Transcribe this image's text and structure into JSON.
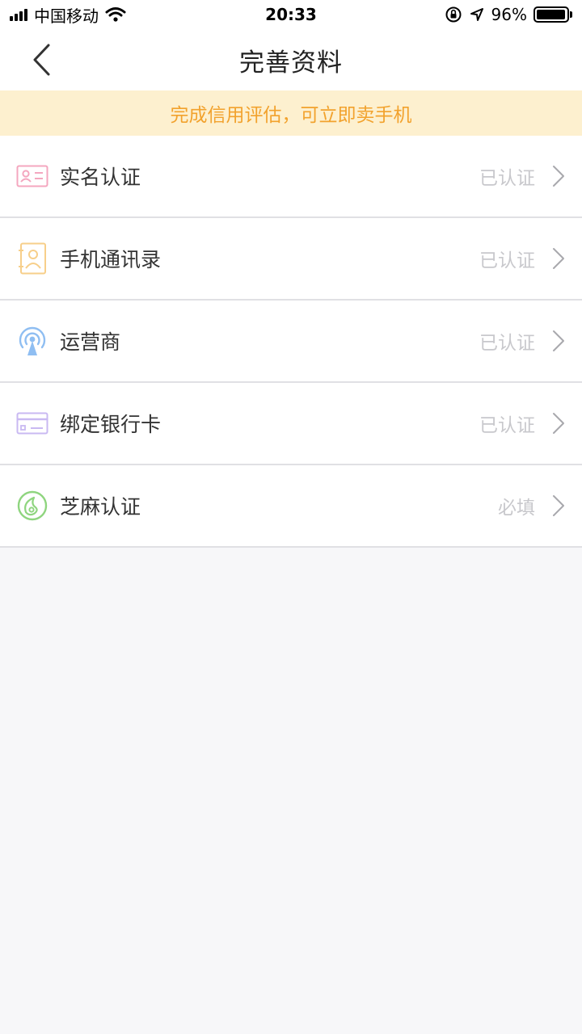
{
  "status_bar": {
    "carrier": "中国移动",
    "time": "20:33",
    "battery": "96%",
    "battery_level": 0.96
  },
  "nav": {
    "title": "完善资料"
  },
  "banner": {
    "text": "完成信用评估，可立即卖手机"
  },
  "items": [
    {
      "label": "实名认证",
      "status": "已认证",
      "icon": "id-card-icon",
      "color": "#f4a7bf"
    },
    {
      "label": "手机通讯录",
      "status": "已认证",
      "icon": "contacts-book-icon",
      "color": "#f7cf8a"
    },
    {
      "label": "运营商",
      "status": "已认证",
      "icon": "signal-tower-icon",
      "color": "#8fbef2"
    },
    {
      "label": "绑定银行卡",
      "status": "已认证",
      "icon": "bank-card-icon",
      "color": "#c9b9f2"
    },
    {
      "label": "芝麻认证",
      "status": "必填",
      "icon": "sesame-icon",
      "color": "#8fd57f"
    }
  ]
}
